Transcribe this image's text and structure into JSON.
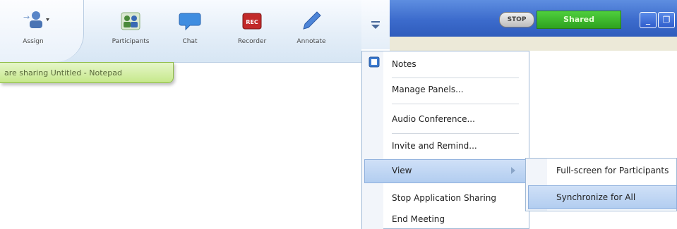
{
  "toolbar": {
    "items": [
      {
        "label": "Assign"
      },
      {
        "label": "Participants"
      },
      {
        "label": "Chat"
      },
      {
        "label": "Recorder"
      },
      {
        "label": "Annotate"
      }
    ],
    "rec_badge": "REC"
  },
  "share_notice": "are sharing Untitled - Notepad",
  "topbar": {
    "stop_label": "STOP",
    "shared_label": "Shared",
    "minimize_glyph": "_",
    "restore_glyph": "❐"
  },
  "menu": {
    "items": [
      {
        "label": "Notes"
      },
      {
        "label": "Manage Panels..."
      },
      {
        "label": "Audio Conference..."
      },
      {
        "label": "Invite and Remind..."
      },
      {
        "label": "View"
      },
      {
        "label": "Stop Application Sharing"
      },
      {
        "label": "End Meeting"
      }
    ]
  },
  "submenu": {
    "items": [
      {
        "label": "Full-screen for Participants"
      },
      {
        "label": "Synchronize for All"
      }
    ]
  },
  "colors": {
    "accent_blue": "#3c6bcc",
    "shared_green": "#2ea21f",
    "notice_green": "#c6e88b"
  }
}
